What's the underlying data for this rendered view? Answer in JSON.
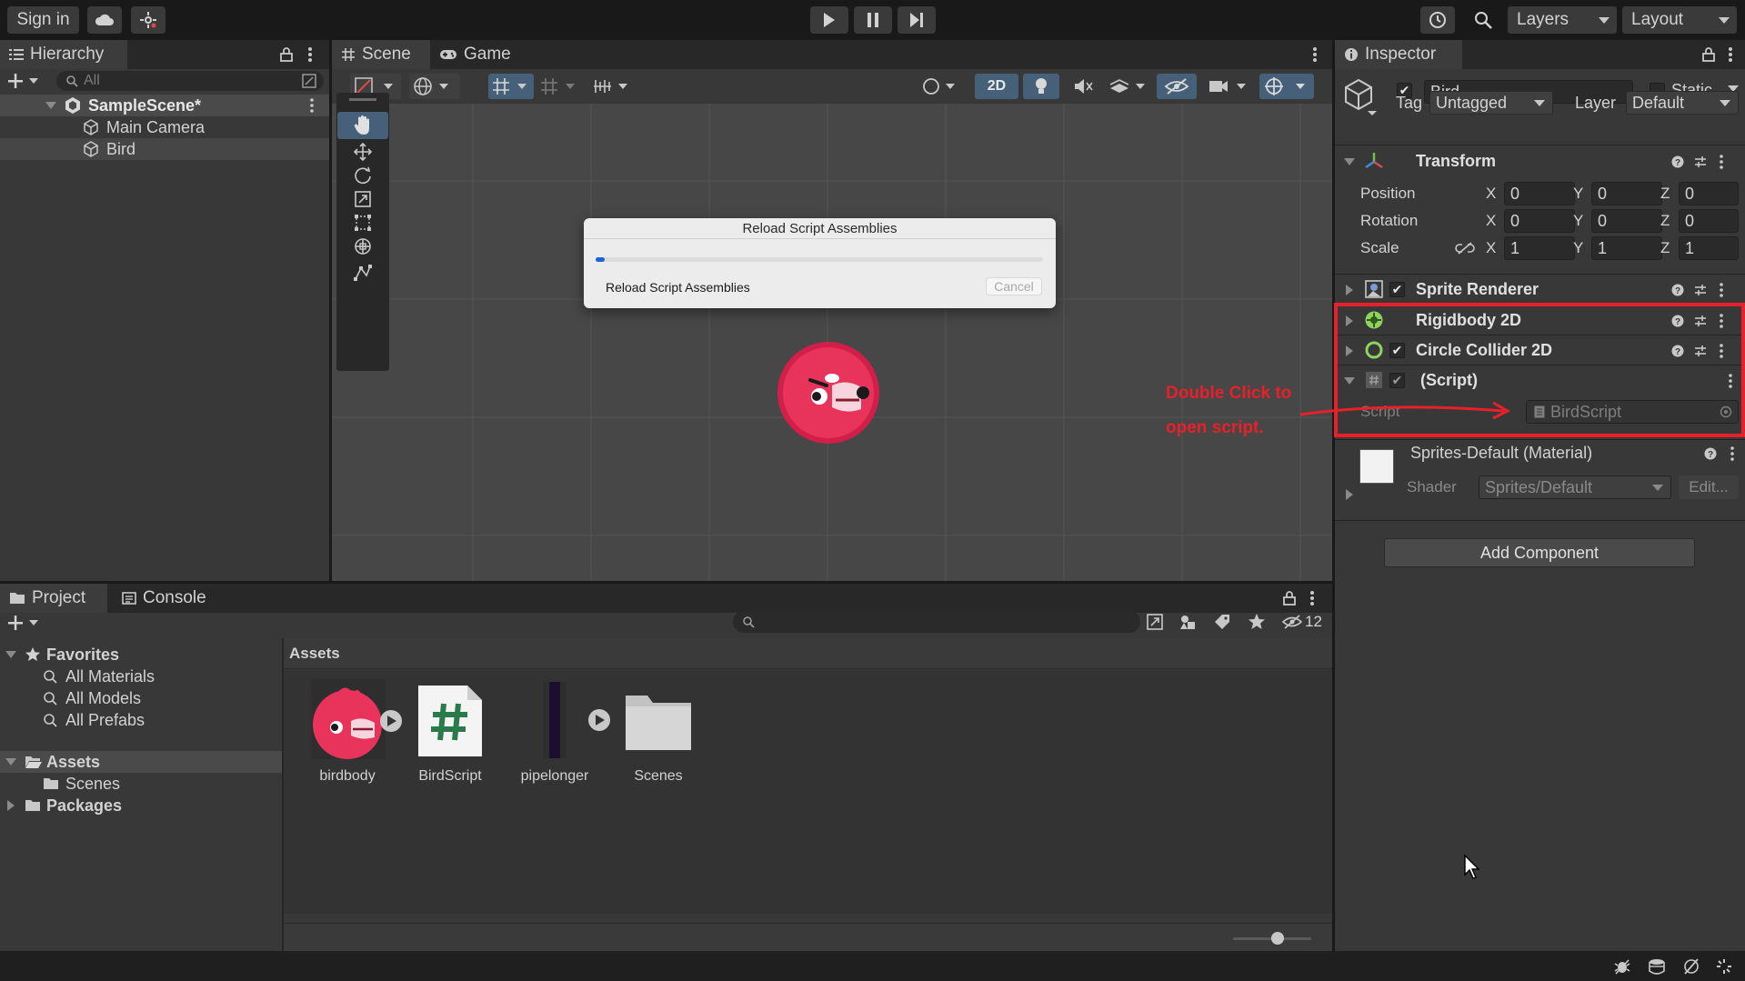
{
  "toolbar": {
    "sign_in": "Sign in",
    "cloud_icon": "cloud-icon",
    "collab_icon": "collab-icon",
    "play_icon": "play-icon",
    "pause_icon": "pause-icon",
    "step_icon": "step-icon",
    "history_icon": "history-icon",
    "search_icon": "search-icon",
    "layers": "Layers",
    "layout": "Layout"
  },
  "hierarchy": {
    "tab": "Hierarchy",
    "search_placeholder": "All",
    "scene": "SampleScene*",
    "items": [
      "Main Camera",
      "Bird"
    ]
  },
  "scene_view": {
    "tabs": [
      "Scene",
      "Game"
    ],
    "toggle_2d": "2D"
  },
  "dialog": {
    "title": "Reload Script Assemblies",
    "message": "Reload Script Assemblies",
    "cancel": "Cancel",
    "progress": 0.02
  },
  "inspector": {
    "tab": "Inspector",
    "object_name": "Bird",
    "static_label": "Static",
    "tag_label": "Tag",
    "tag_value": "Untagged",
    "layer_label": "Layer",
    "layer_value": "Default",
    "transform": {
      "title": "Transform",
      "position_label": "Position",
      "rotation_label": "Rotation",
      "scale_label": "Scale",
      "axis_x": "X",
      "axis_y": "Y",
      "axis_z": "Z",
      "position": [
        "0",
        "0",
        "0"
      ],
      "rotation": [
        "0",
        "0",
        "0"
      ],
      "scale": [
        "1",
        "1",
        "1"
      ]
    },
    "components": [
      "Sprite Renderer",
      "Rigidbody 2D",
      "Circle Collider 2D",
      "(Script)"
    ],
    "script_label": "Script",
    "script_value": "BirdScript",
    "material_name": "Sprites-Default (Material)",
    "shader_label": "Shader",
    "shader_value": "Sprites/Default",
    "edit_button": "Edit...",
    "add_component": "Add Component",
    "annotation": [
      "Double Click to",
      "open script."
    ],
    "annotation_color": "#e8202a"
  },
  "project": {
    "tabs": [
      "Project",
      "Console"
    ],
    "hidden_count": "12",
    "favorites_label": "Favorites",
    "favorites": [
      "All Materials",
      "All Models",
      "All Prefabs"
    ],
    "assets_label": "Assets",
    "asset_folders": [
      "Scenes"
    ],
    "packages_label": "Packages",
    "breadcrumb": "Assets",
    "grid_items": [
      "birdbody",
      "BirdScript",
      "pipelonger",
      "Scenes"
    ]
  }
}
